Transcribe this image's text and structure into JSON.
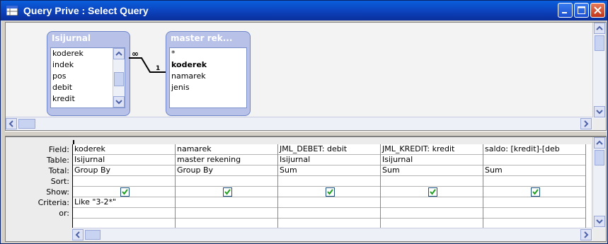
{
  "window": {
    "title": "Query Prive : Select Query"
  },
  "tables": [
    {
      "title": "Isijurnal",
      "fields": [
        "koderek",
        "indek",
        "pos",
        "debit",
        "kredit"
      ]
    },
    {
      "title": "master rek...",
      "fields": [
        "*",
        "koderek",
        "namarek",
        "jenis"
      ]
    }
  ],
  "relation": {
    "many_label": "∞",
    "one_label": "1"
  },
  "grid": {
    "row_labels": [
      "Field:",
      "Table:",
      "Total:",
      "Sort:",
      "Show:",
      "Criteria:",
      "or:"
    ],
    "columns": [
      {
        "field": "koderek",
        "table": "Isijurnal",
        "total": "Group By",
        "sort": "",
        "show": true,
        "criteria": "Like \"3-2*\"",
        "or": ""
      },
      {
        "field": "namarek",
        "table": "master rekening",
        "total": "Group By",
        "sort": "",
        "show": true,
        "criteria": "",
        "or": ""
      },
      {
        "field": "JML_DEBET: debit",
        "table": "Isijurnal",
        "total": "Sum",
        "sort": "",
        "show": true,
        "criteria": "",
        "or": ""
      },
      {
        "field": "JML_KREDIT: kredit",
        "table": "Isijurnal",
        "total": "Sum",
        "sort": "",
        "show": true,
        "criteria": "",
        "or": ""
      },
      {
        "field": "saldo: [kredit]-[deb",
        "table": "",
        "total": "Sum",
        "sort": "",
        "show": true,
        "criteria": "",
        "or": ""
      }
    ]
  }
}
